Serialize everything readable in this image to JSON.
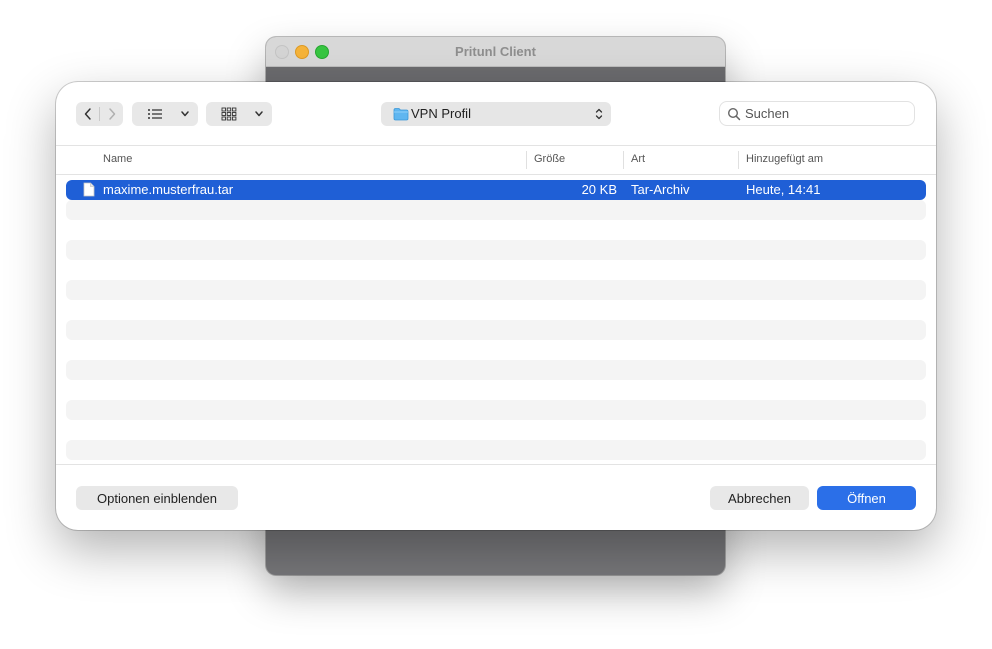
{
  "background_window": {
    "title": "Pritunl Client"
  },
  "dialog": {
    "location": "VPN Profil",
    "search": {
      "placeholder": "Suchen",
      "value": ""
    },
    "columns": {
      "name": "Name",
      "size": "Größe",
      "kind": "Art",
      "added": "Hinzugefügt am"
    },
    "files": [
      {
        "name": "maxime.musterfrau.tar",
        "size": "20 KB",
        "kind": "Tar-Archiv",
        "added": "Heute, 14:41",
        "selected": true
      }
    ],
    "buttons": {
      "options": "Optionen einblenden",
      "cancel": "Abbrechen",
      "open": "Öffnen"
    }
  },
  "colors": {
    "selection": "#1f5fd6",
    "primary_button": "#2b6fe8"
  },
  "icons": {
    "back": "chevron-left-icon",
    "forward": "chevron-right-icon",
    "list_view": "list-view-icon",
    "gallery_view": "grid-view-icon",
    "folder": "folder-icon",
    "search": "search-icon",
    "file": "document-icon"
  }
}
